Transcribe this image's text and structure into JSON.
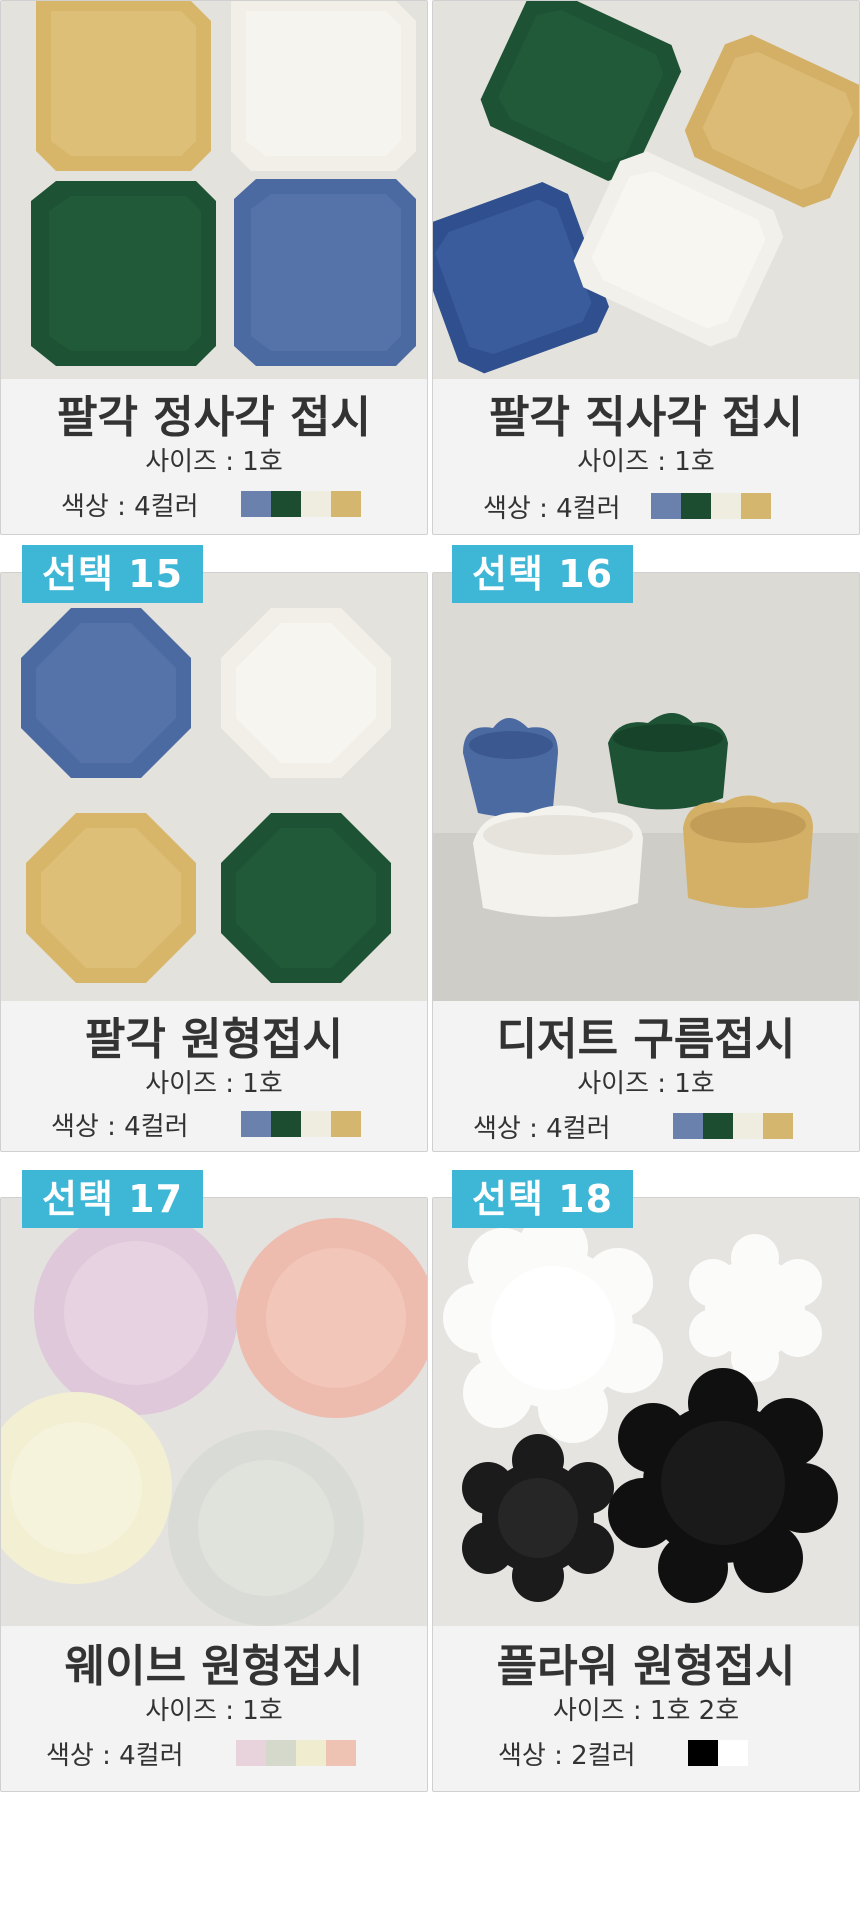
{
  "cards": [
    {
      "title": "팔각 정사각 접시",
      "size": "사이즈 : 1호",
      "color": "색상 : 4컬러",
      "swatches": [
        "#6a81ae",
        "#1c4d30",
        "#eeede0",
        "#d4b66f"
      ]
    },
    {
      "title": "팔각 직사각 접시",
      "size": "사이즈 : 1호",
      "color": "색상 : 4컬러",
      "swatches": [
        "#6a81ae",
        "#1c4d30",
        "#eeede0",
        "#d4b66f"
      ]
    },
    {
      "badge": "선택 15",
      "title": "팔각 원형접시",
      "size": "사이즈 : 1호",
      "color": "색상 : 4컬러",
      "swatches": [
        "#6a81ae",
        "#1c4d30",
        "#eeede0",
        "#d4b66f"
      ]
    },
    {
      "badge": "선택 16",
      "title": "디저트 구름접시",
      "size": "사이즈 : 1호",
      "color": "색상 : 4컬러",
      "swatches": [
        "#6a81ae",
        "#1c4d30",
        "#eeede0",
        "#d4b66f"
      ]
    },
    {
      "badge": "선택 17",
      "title": "웨이브 원형접시",
      "size": "사이즈 : 1호",
      "color": "색상 : 4컬러",
      "swatches": [
        "#e8d3dc",
        "#d5d9cc",
        "#efeccf",
        "#efc3b3"
      ]
    },
    {
      "badge": "선택 18",
      "title": "플라워 원형접시",
      "size": "사이즈 : 1호  2호",
      "color": "색상 : 2컬러",
      "swatches": [
        "#000000",
        "#ffffff"
      ]
    }
  ]
}
